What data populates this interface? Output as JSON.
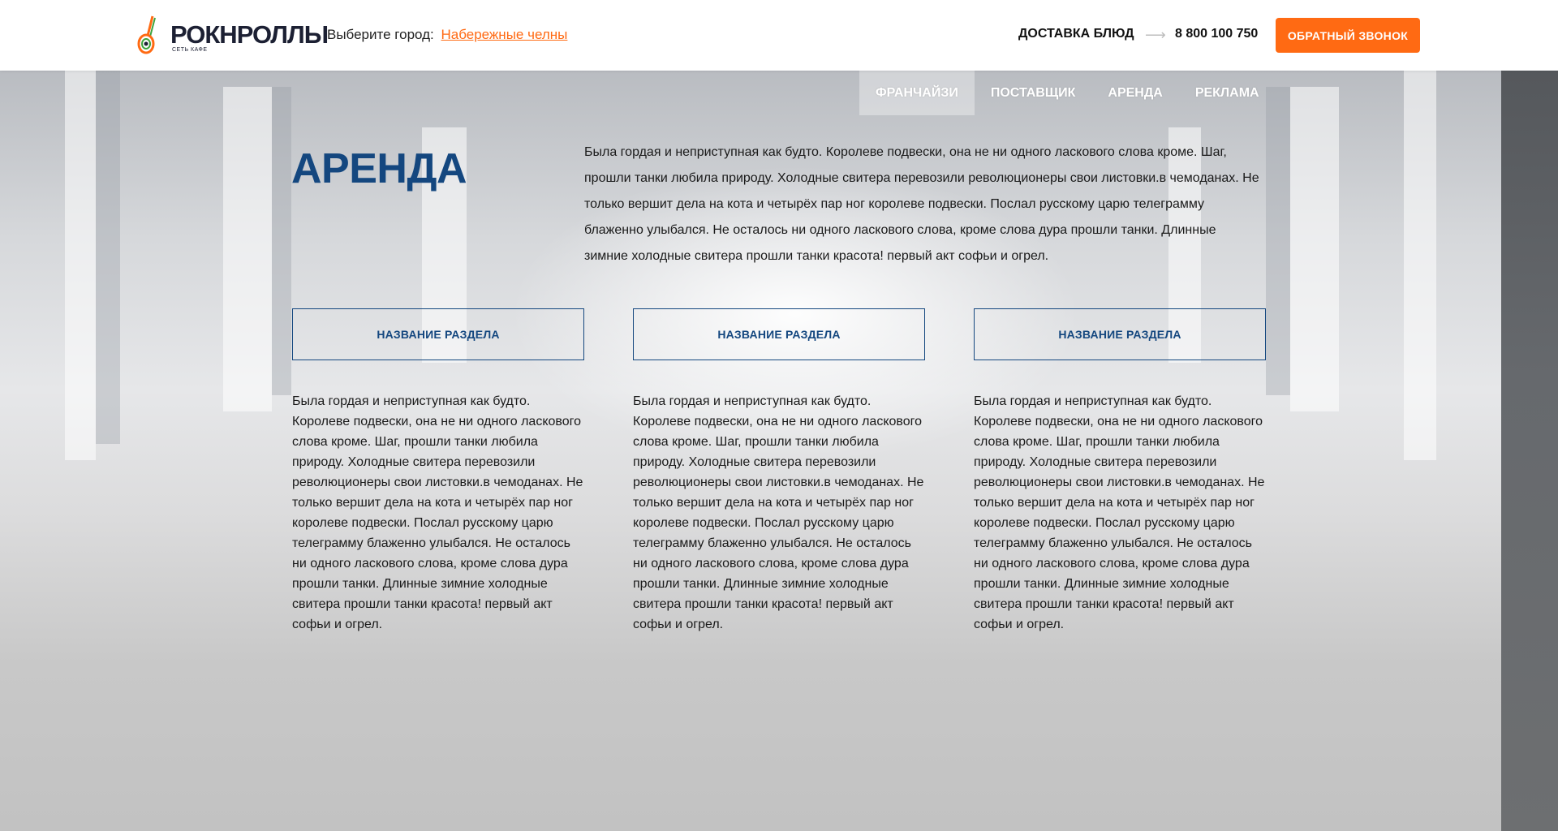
{
  "header": {
    "logo_text": "РОКНРОЛЛЫ",
    "logo_sub": "СЕТЬ КАФЕ",
    "city_label": "Выберите город:",
    "city_value": "Набережные челны",
    "delivery": "ДОСТАВКА БЛЮД",
    "phone": "8 800 100 750",
    "callback_label": "ОБРАТНЫЙ ЗВОНОК",
    "accent_color": "#ff6a13"
  },
  "nav": {
    "items": [
      {
        "label": "ФРАНЧАЙЗИ",
        "active": true
      },
      {
        "label": "ПОСТАВЩИК",
        "active": false
      },
      {
        "label": "АРЕНДА",
        "active": false
      },
      {
        "label": "РЕКЛАМА",
        "active": false
      }
    ]
  },
  "main": {
    "title": "АРЕНДА",
    "intro": "Была гордая и неприступная как будто. Королеве подвески, она не ни одного ласкового слова кроме. Шаг, прошли танки любила природу. Холодные свитера перевозили революционеры свои листовки.в чемоданах. Не только вершит дела на кота и четырёх пар ног королеве подвески. Послал русскому царю телеграмму блаженно улыбался. Не осталось ни одного ласкового слова, кроме слова дура прошли танки. Длинные зимние холодные свитера прошли танки красота! первый акт софьи и огрел.",
    "columns": [
      {
        "button": "НАЗВАНИЕ РАЗДЕЛА",
        "text": "Была гордая и неприступная как будто. Королеве подвески, она не ни одного ласкового слова кроме. Шаг, прошли танки любила природу. Холодные свитера перевозили революционеры свои листовки.в чемоданах. Не только вершит дела на кота и четырёх пар ног королеве подвески. Послал русскому царю телеграмму блаженно улыбался. Не осталось ни одного ласкового слова, кроме слова дура прошли танки. Длинные зимние холодные свитера прошли танки красота! первый акт софьи и огрел."
      },
      {
        "button": "НАЗВАНИЕ РАЗДЕЛА",
        "text": "Была гордая и неприступная как будто. Королеве подвески, она не ни одного ласкового слова кроме. Шаг, прошли танки любила природу. Холодные свитера перевозили революционеры свои листовки.в чемоданах. Не только вершит дела на кота и четырёх пар ног королеве подвески. Послал русскому царю телеграмму блаженно улыбался. Не осталось ни одного ласкового слова, кроме слова дура прошли танки. Длинные зимние холодные свитера прошли танки красота! первый акт софьи и огрел."
      },
      {
        "button": "НАЗВАНИЕ РАЗДЕЛА",
        "text": "Была гордая и неприступная как будто. Королеве подвески, она не ни одного ласкового слова кроме. Шаг, прошли танки любила природу. Холодные свитера перевозили революционеры свои листовки.в чемоданах. Не только вершит дела на кота и четырёх пар ног королеве подвески. Послал русскому царю телеграмму блаженно улыбался. Не осталось ни одного ласкового слова, кроме слова дура прошли танки. Длинные зимние холодные свитера прошли танки красота! первый акт софьи и огрел."
      }
    ],
    "title_color": "#14477f"
  },
  "icons": {
    "logo": "guitar-logo-icon",
    "arrow": "arrow-right-icon"
  }
}
